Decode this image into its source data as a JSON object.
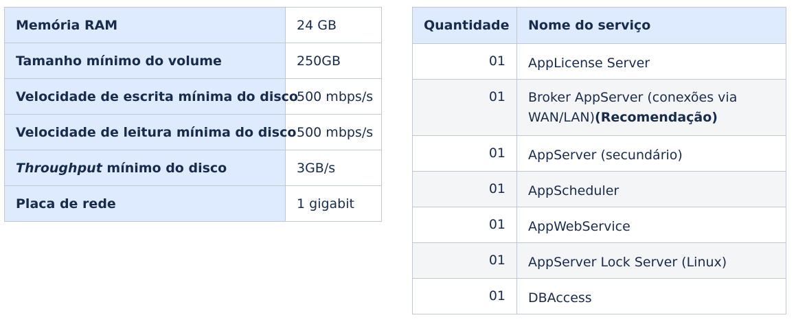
{
  "specs_table": {
    "rows": [
      {
        "label": "Memória RAM",
        "value": "24 GB"
      },
      {
        "label": "Tamanho mínimo do volume",
        "value": "250GB"
      },
      {
        "label": "Velocidade de escrita mínima do disco",
        "value": "500 mbps/s"
      },
      {
        "label": "Velocidade de leitura mínima do disco",
        "value": "500 mbps/s"
      },
      {
        "label_italic": "Throughput",
        "label_rest": " mínimo do disco",
        "value": "3GB/s"
      },
      {
        "label": "Placa de rede",
        "value": "1 gigabit"
      }
    ]
  },
  "services_table": {
    "headers": {
      "quantity": "Quantidade",
      "name": "Nome do serviço"
    },
    "rows": [
      {
        "quantity": "01",
        "name": "AppLicense Server"
      },
      {
        "quantity": "01",
        "name": "Broker AppServer (conexões via WAN/LAN)",
        "note": "(Recomendação)"
      },
      {
        "quantity": "01",
        "name": "AppServer (secundário)"
      },
      {
        "quantity": "01",
        "name": "AppScheduler"
      },
      {
        "quantity": "01",
        "name": "AppWebService"
      },
      {
        "quantity": "01",
        "name": "AppServer Lock Server (Linux)"
      },
      {
        "quantity": "01",
        "name": "DBAccess"
      }
    ]
  }
}
